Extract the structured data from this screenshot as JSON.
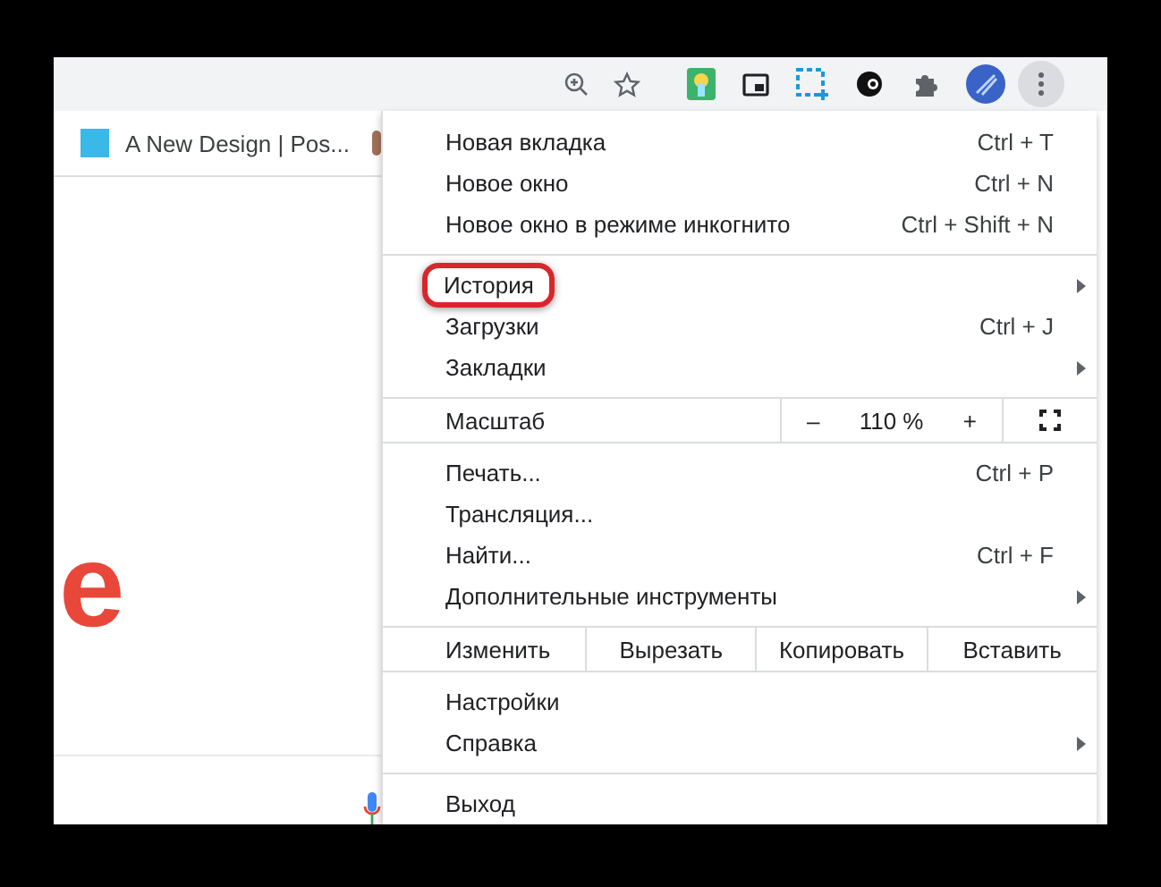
{
  "bookmarks_bar": {
    "items": [
      {
        "label": "A New Design | Pos..."
      }
    ]
  },
  "page": {
    "logo_text": "e"
  },
  "menu": {
    "sections": [
      [
        {
          "kind": "item",
          "label": "Новая вкладка",
          "shortcut": "Ctrl + T",
          "submenu": false,
          "highlighted": false
        },
        {
          "kind": "item",
          "label": "Новое окно",
          "shortcut": "Ctrl + N",
          "submenu": false,
          "highlighted": false
        },
        {
          "kind": "item",
          "label": "Новое окно в режиме инкогнито",
          "shortcut": "Ctrl + Shift + N",
          "submenu": false,
          "highlighted": false
        }
      ],
      [
        {
          "kind": "item",
          "label": "История",
          "submenu": true,
          "highlighted": true
        },
        {
          "kind": "item",
          "label": "Загрузки",
          "shortcut": "Ctrl + J",
          "submenu": false,
          "highlighted": false
        },
        {
          "kind": "item",
          "label": "Закладки",
          "submenu": true,
          "highlighted": false
        }
      ],
      [
        {
          "kind": "zoom",
          "label": "Масштаб",
          "minus": "–",
          "value": "110 %",
          "plus": "+"
        }
      ],
      [
        {
          "kind": "item",
          "label": "Печать...",
          "shortcut": "Ctrl + P",
          "submenu": false,
          "highlighted": false
        },
        {
          "kind": "item",
          "label": "Трансляция...",
          "submenu": false,
          "highlighted": false
        },
        {
          "kind": "item",
          "label": "Найти...",
          "shortcut": "Ctrl + F",
          "submenu": false,
          "highlighted": false
        },
        {
          "kind": "item",
          "label": "Дополнительные инструменты",
          "submenu": true,
          "highlighted": false
        }
      ],
      [
        {
          "kind": "edit",
          "label": "Изменить",
          "buttons": [
            "Вырезать",
            "Копировать",
            "Вставить"
          ]
        }
      ],
      [
        {
          "kind": "item",
          "label": "Настройки",
          "submenu": false,
          "highlighted": false
        },
        {
          "kind": "item",
          "label": "Справка",
          "submenu": true,
          "highlighted": false
        }
      ],
      [
        {
          "kind": "item",
          "label": "Выход",
          "submenu": false,
          "highlighted": false
        }
      ]
    ]
  }
}
